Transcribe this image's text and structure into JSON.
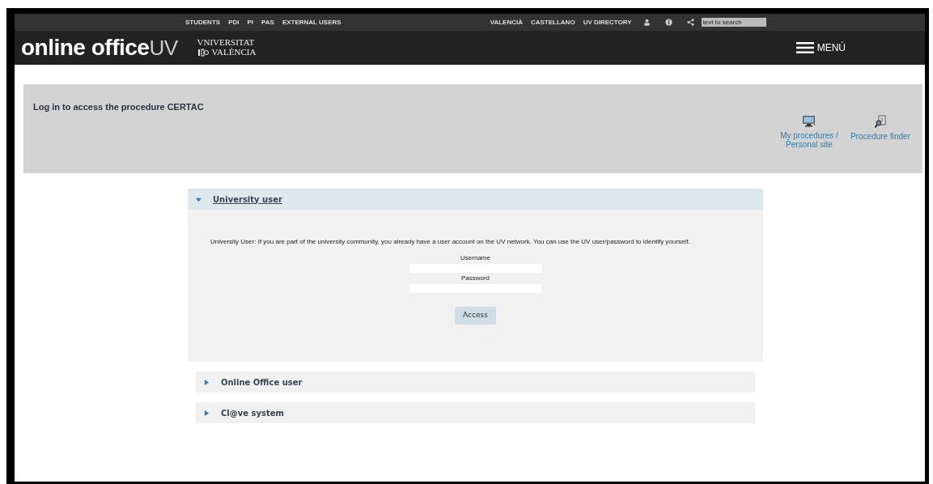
{
  "top_links": [
    "STUDENTS",
    "PDI",
    "PI",
    "PAS",
    "EXTERNAL USERS"
  ],
  "lang_links": [
    "VALENCIÀ",
    "CASTELLANO",
    "UV DIRECTORY"
  ],
  "search": {
    "placeholder": "text to search"
  },
  "logo": {
    "main": "online office",
    "suffix": "UV",
    "university_line_1": "VNIVERSITAT",
    "university_line_2": "VALÈNCIA"
  },
  "menu_button": "MENÚ",
  "banner": {
    "title": "Log in to access the procedure CERTAC",
    "shortcuts": [
      {
        "kind": "screen",
        "label": "My procedures / Personal site"
      },
      {
        "kind": "finder",
        "label": "Procedure finder"
      }
    ]
  },
  "sections": [
    {
      "title": "University user",
      "expanded": true,
      "description": "University User: If you are part of the university community, you already have a user account on the UV network. You can use the UV user/password to identify yourself.",
      "fields": [
        {
          "label": "Username"
        },
        {
          "label": "Password"
        }
      ],
      "button": "Access"
    },
    {
      "title": "Online Office user",
      "expanded": false
    },
    {
      "title": "Cl@ve system",
      "expanded": false
    }
  ]
}
